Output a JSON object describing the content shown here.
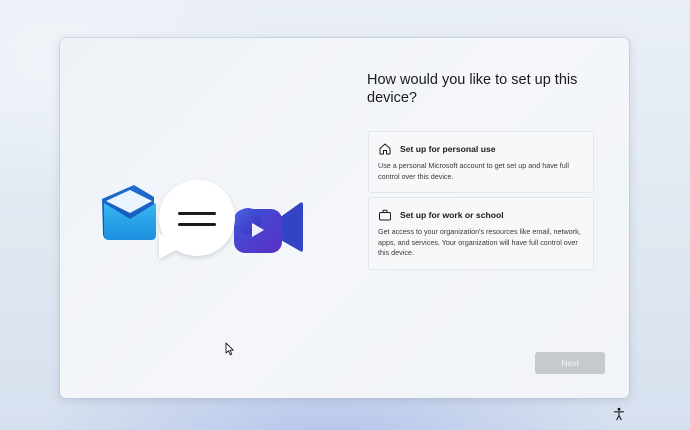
{
  "setup": {
    "title": "How would you like to set up this device?",
    "hero_icons": [
      "mail-icon",
      "chat-bubble-icon",
      "video-call-icon"
    ],
    "options": [
      {
        "icon": "home-icon",
        "label": "Set up for personal use",
        "description": "Use a personal Microsoft account to get set up and have full control over this device."
      },
      {
        "icon": "briefcase-icon",
        "label": "Set up for work or school",
        "description": "Get access to your organization's resources like email, network, apps, and services. Your organization will have full control over this device."
      }
    ],
    "next_label": "Next"
  },
  "taskbar": {
    "accessibility_icon": "accessibility-icon"
  },
  "colors": {
    "accent_blue": "#2b6bd6",
    "next_disabled": "#c6cacf",
    "card_bg": "#f2f5f8"
  }
}
